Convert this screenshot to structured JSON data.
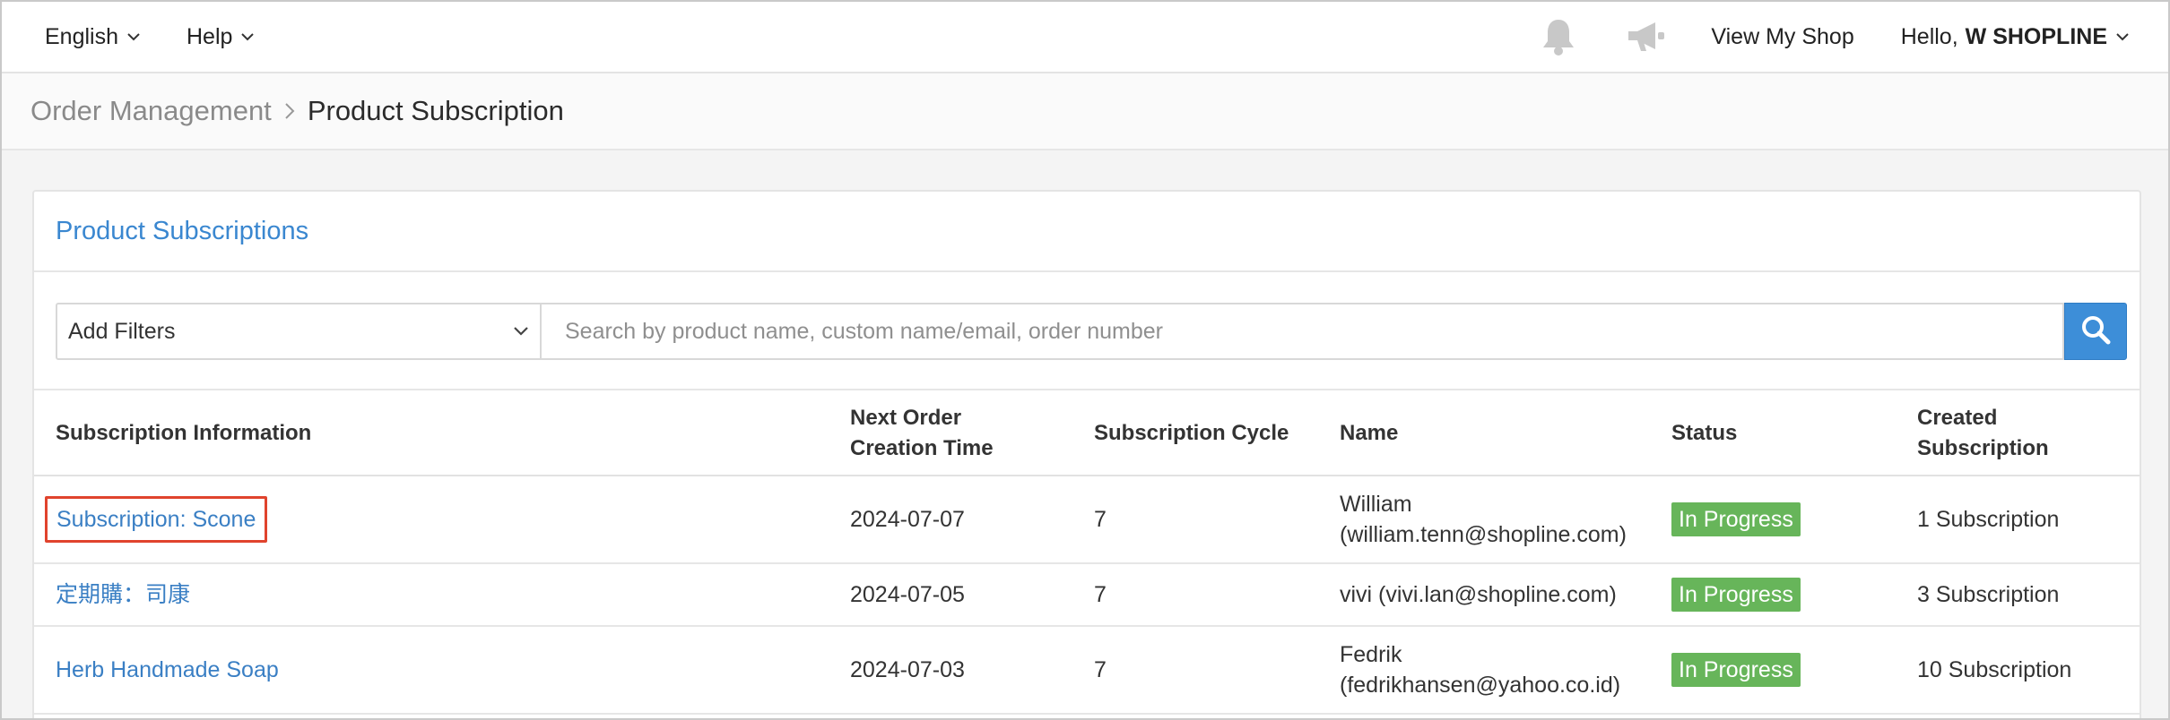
{
  "topbar": {
    "language": "English",
    "help": "Help",
    "view_shop": "View My Shop",
    "greeting": "Hello,",
    "user": "W SHOPLINE"
  },
  "breadcrumb": {
    "parent": "Order Management",
    "current": "Product Subscription"
  },
  "panel": {
    "title": "Product Subscriptions",
    "filter_label": "Add Filters",
    "search_placeholder": "Search by product name, custom name/email, order number"
  },
  "table": {
    "headers": {
      "info": "Subscription Information",
      "next_order_1": "Next Order",
      "next_order_2": "Creation Time",
      "cycle": "Subscription Cycle",
      "name": "Name",
      "status": "Status",
      "created_1": "Created",
      "created_2": "Subscription"
    },
    "rows": [
      {
        "info": "Subscription: Scone",
        "next_order": "2024-07-07",
        "cycle": "7",
        "name_1": "William",
        "name_2": "(william.tenn@shopline.com)",
        "status": "In Progress",
        "created": "1 Subscription"
      },
      {
        "info": "定期購：司康",
        "next_order": "2024-07-05",
        "cycle": "7",
        "name_1": "vivi (vivi.lan@shopline.com)",
        "status": "In Progress",
        "created": "3 Subscription"
      },
      {
        "info": "Herb Handmade Soap",
        "next_order": "2024-07-03",
        "cycle": "7",
        "name_1": "Fedrik",
        "name_2": "(fedrikhansen@yahoo.co.id)",
        "status": "In Progress",
        "created": "10 Subscription"
      }
    ]
  },
  "colors": {
    "link": "#3a7fc4",
    "badge": "#67b55a",
    "search_button": "#3d8ed8",
    "highlight": "#e0432d"
  },
  "icons": [
    "chevron-down-icon",
    "bell-icon",
    "megaphone-icon",
    "chevron-right-icon",
    "search-icon"
  ]
}
